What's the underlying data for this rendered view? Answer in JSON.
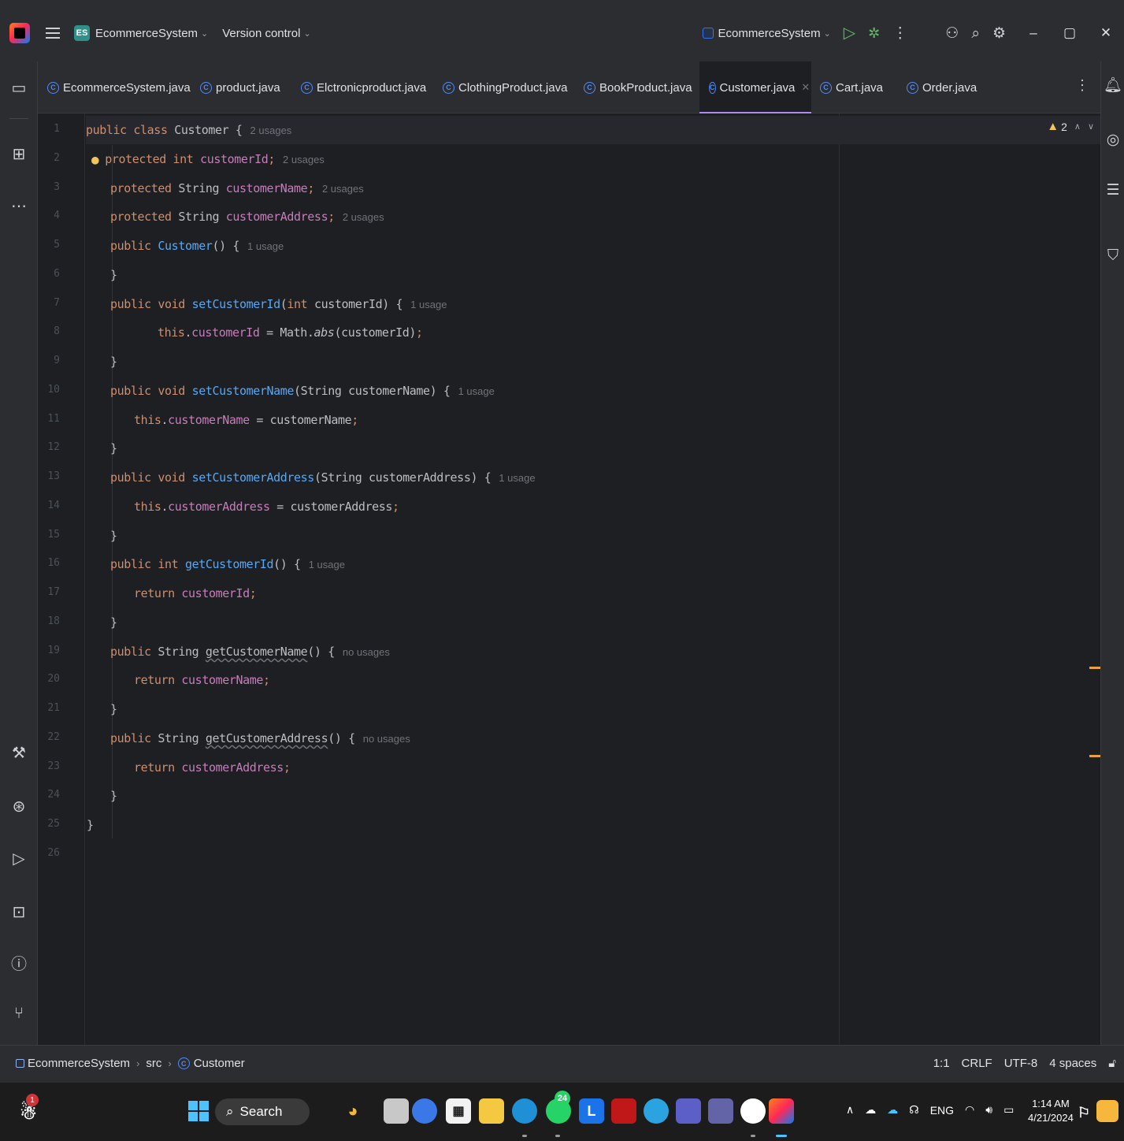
{
  "titlebar": {
    "project_badge": "ES",
    "project_name": "EcommerceSystem",
    "version_control": "Version control",
    "run_config": "EcommerceSystem"
  },
  "tabs": [
    {
      "label": "EcommerceSystem.java",
      "active": false
    },
    {
      "label": "product.java",
      "active": false
    },
    {
      "label": "Elctronicproduct.java",
      "active": false
    },
    {
      "label": "ClothingProduct.java",
      "active": false
    },
    {
      "label": "BookProduct.java",
      "active": false
    },
    {
      "label": "Customer.java",
      "active": true
    },
    {
      "label": "Cart.java",
      "active": false
    },
    {
      "label": "Order.java",
      "active": false
    }
  ],
  "editor": {
    "line_numbers": [
      "1",
      "2",
      "3",
      "4",
      "5",
      "6",
      "7",
      "8",
      "9",
      "10",
      "11",
      "12",
      "13",
      "14",
      "15",
      "16",
      "17",
      "18",
      "19",
      "20",
      "21",
      "22",
      "23",
      "24",
      "25",
      "26"
    ],
    "inspection_warnings": "2",
    "hints": {
      "l1": "2 usages",
      "l2": "2 usages",
      "l3": "2 usages",
      "l4": "2 usages",
      "l5": "1 usage",
      "l7": "1 usage",
      "l10": "1 usage",
      "l13": "1 usage",
      "l16": "1 usage",
      "l19": "no usages",
      "l22": "no usages"
    }
  },
  "statusbar": {
    "breadcrumbs": [
      "EcommerceSystem",
      "src",
      "Customer"
    ],
    "position": "1:1",
    "line_ending": "CRLF",
    "encoding": "UTF-8",
    "indent": "4 spaces"
  },
  "taskbar": {
    "search_label": "Search",
    "notification_count": "1",
    "whatsapp_badge": "24",
    "language": "ENG",
    "time": "1:14 AM",
    "date": "4/21/2024"
  },
  "colors": {
    "accent_tab": "#b189f5",
    "keyword": "#cf8e6d",
    "field": "#c77dbb",
    "function": "#56a8f5",
    "warning": "#f2c55c"
  }
}
